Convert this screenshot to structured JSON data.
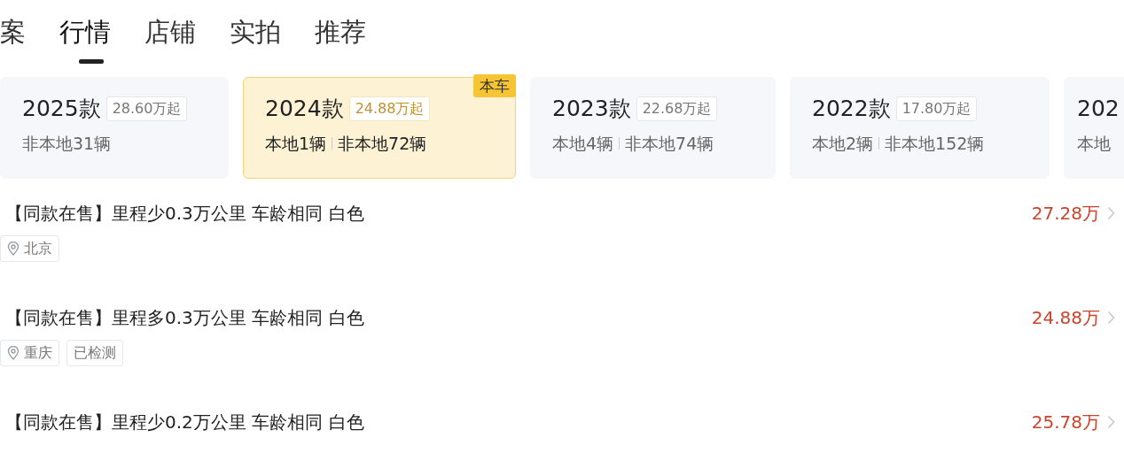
{
  "tabs": [
    {
      "label": "案",
      "selected": false
    },
    {
      "label": "行情",
      "selected": true
    },
    {
      "label": "店铺",
      "selected": false
    },
    {
      "label": "实拍",
      "selected": false
    },
    {
      "label": "推荐",
      "selected": false
    }
  ],
  "model_years": [
    {
      "year": "2025款",
      "price": "28.60万起",
      "counts": [
        "非本地31辆"
      ],
      "selected": false
    },
    {
      "year": "2024款",
      "price": "24.88万起",
      "counts": [
        "本地1辆",
        "非本地72辆"
      ],
      "selected": true,
      "badge": "本车"
    },
    {
      "year": "2023款",
      "price": "22.68万起",
      "counts": [
        "本地4辆",
        "非本地74辆"
      ],
      "selected": false
    },
    {
      "year": "2022款",
      "price": "17.80万起",
      "counts": [
        "本地2辆",
        "非本地152辆"
      ],
      "selected": false
    },
    {
      "year": "202",
      "counts": [
        "本地"
      ],
      "selected": false
    }
  ],
  "listings": [
    {
      "title": "【同款在售】里程少0.3万公里 车龄相同 白色",
      "price": "27.28万",
      "tags": [
        {
          "kind": "location",
          "text": "北京"
        }
      ]
    },
    {
      "title": "【同款在售】里程多0.3万公里 车龄相同 白色",
      "price": "24.88万",
      "tags": [
        {
          "kind": "location",
          "text": "重庆"
        },
        {
          "kind": "plain",
          "text": "已检测"
        }
      ]
    },
    {
      "title": "【同款在售】里程少0.2万公里 车龄相同 白色",
      "price": "25.78万"
    }
  ]
}
